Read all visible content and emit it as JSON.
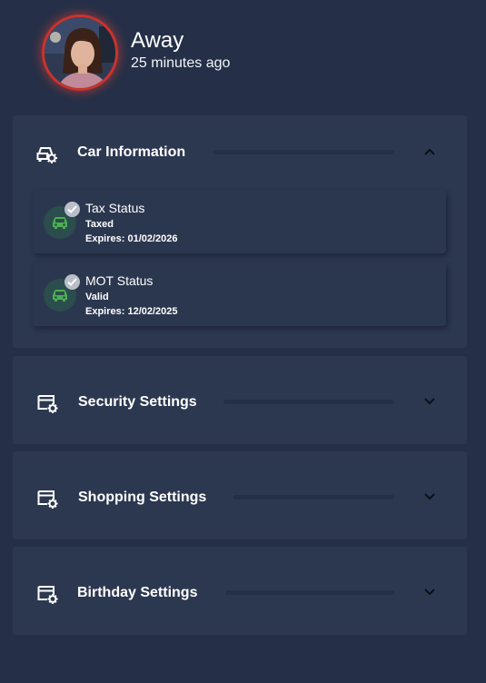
{
  "profile": {
    "status": "Away",
    "last_seen": "25 minutes ago"
  },
  "panels": [
    {
      "title": "Car Information",
      "expanded": true,
      "icon": "car-settings-icon",
      "items": [
        {
          "title": "Tax Status",
          "value": "Taxed",
          "expiry": "Expires: 01/02/2026",
          "icon": "car-icon",
          "badge": "check-icon"
        },
        {
          "title": "MOT Status",
          "value": "Valid",
          "expiry": "Expires: 12/02/2025",
          "icon": "car-icon",
          "badge": "check-icon"
        }
      ]
    },
    {
      "title": "Security Settings",
      "expanded": false,
      "icon": "settings-icon"
    },
    {
      "title": "Shopping Settings",
      "expanded": false,
      "icon": "settings-icon"
    },
    {
      "title": "Birthday Settings",
      "expanded": false,
      "icon": "settings-icon"
    }
  ],
  "colors": {
    "background": "#253048",
    "panel": "#2c3850",
    "avatar_ring": "#c8342c",
    "car_icon": "#4caf50",
    "car_icon_bg": "#2b4d4d",
    "badge": "#b9bec8"
  }
}
